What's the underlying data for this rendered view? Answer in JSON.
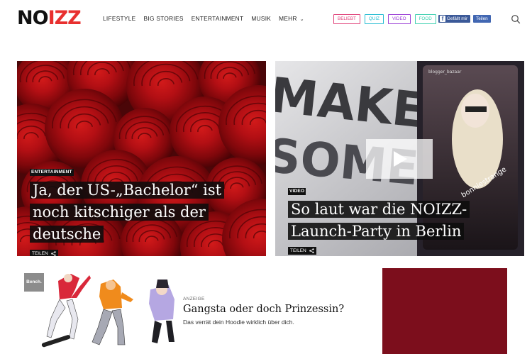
{
  "logo": {
    "part1": "NO",
    "part2": "IZZ"
  },
  "nav": {
    "items": [
      "LIFESTYLE",
      "BIG STORIES",
      "ENTERTAINMENT",
      "MUSIK",
      "MEHR"
    ]
  },
  "tags": [
    {
      "label": "BELIEBT",
      "color": "#e0427a"
    },
    {
      "label": "QUIZ",
      "color": "#25bcd2"
    },
    {
      "label": "VIDEO",
      "color": "#9b3fd6"
    },
    {
      "label": "FOOD",
      "color": "#3fd0b0"
    }
  ],
  "social": {
    "facebook_label": "Gefällt mir",
    "share_label": "Teilen"
  },
  "features": [
    {
      "category": "ENTERTAINMENT",
      "headline_lines": [
        "Ja, der US-„Bachelor“ ist",
        "noch kitschiger als der",
        "deutsche"
      ],
      "share": "TEILEN"
    },
    {
      "category": "VIDEO",
      "headline_lines": [
        "So laut war die NOIZZ-",
        "Launch-Party in Berlin"
      ],
      "share": "TEILEN",
      "image_text": {
        "big1": "MAKE",
        "big2": "SOME",
        "tag": "bonniestrange",
        "user": "blogger_bazaar"
      }
    }
  ],
  "ad": {
    "brand": "Bench.",
    "label": "ANZEIGE",
    "title": "Gangsta oder doch Prinzessin?",
    "subtitle": "Das verrät dein Hoodie wirklich über dich."
  },
  "colors": {
    "logo_red": "#e8302f",
    "maroon": "#7c0e1c",
    "facebook": "#3b5998"
  }
}
